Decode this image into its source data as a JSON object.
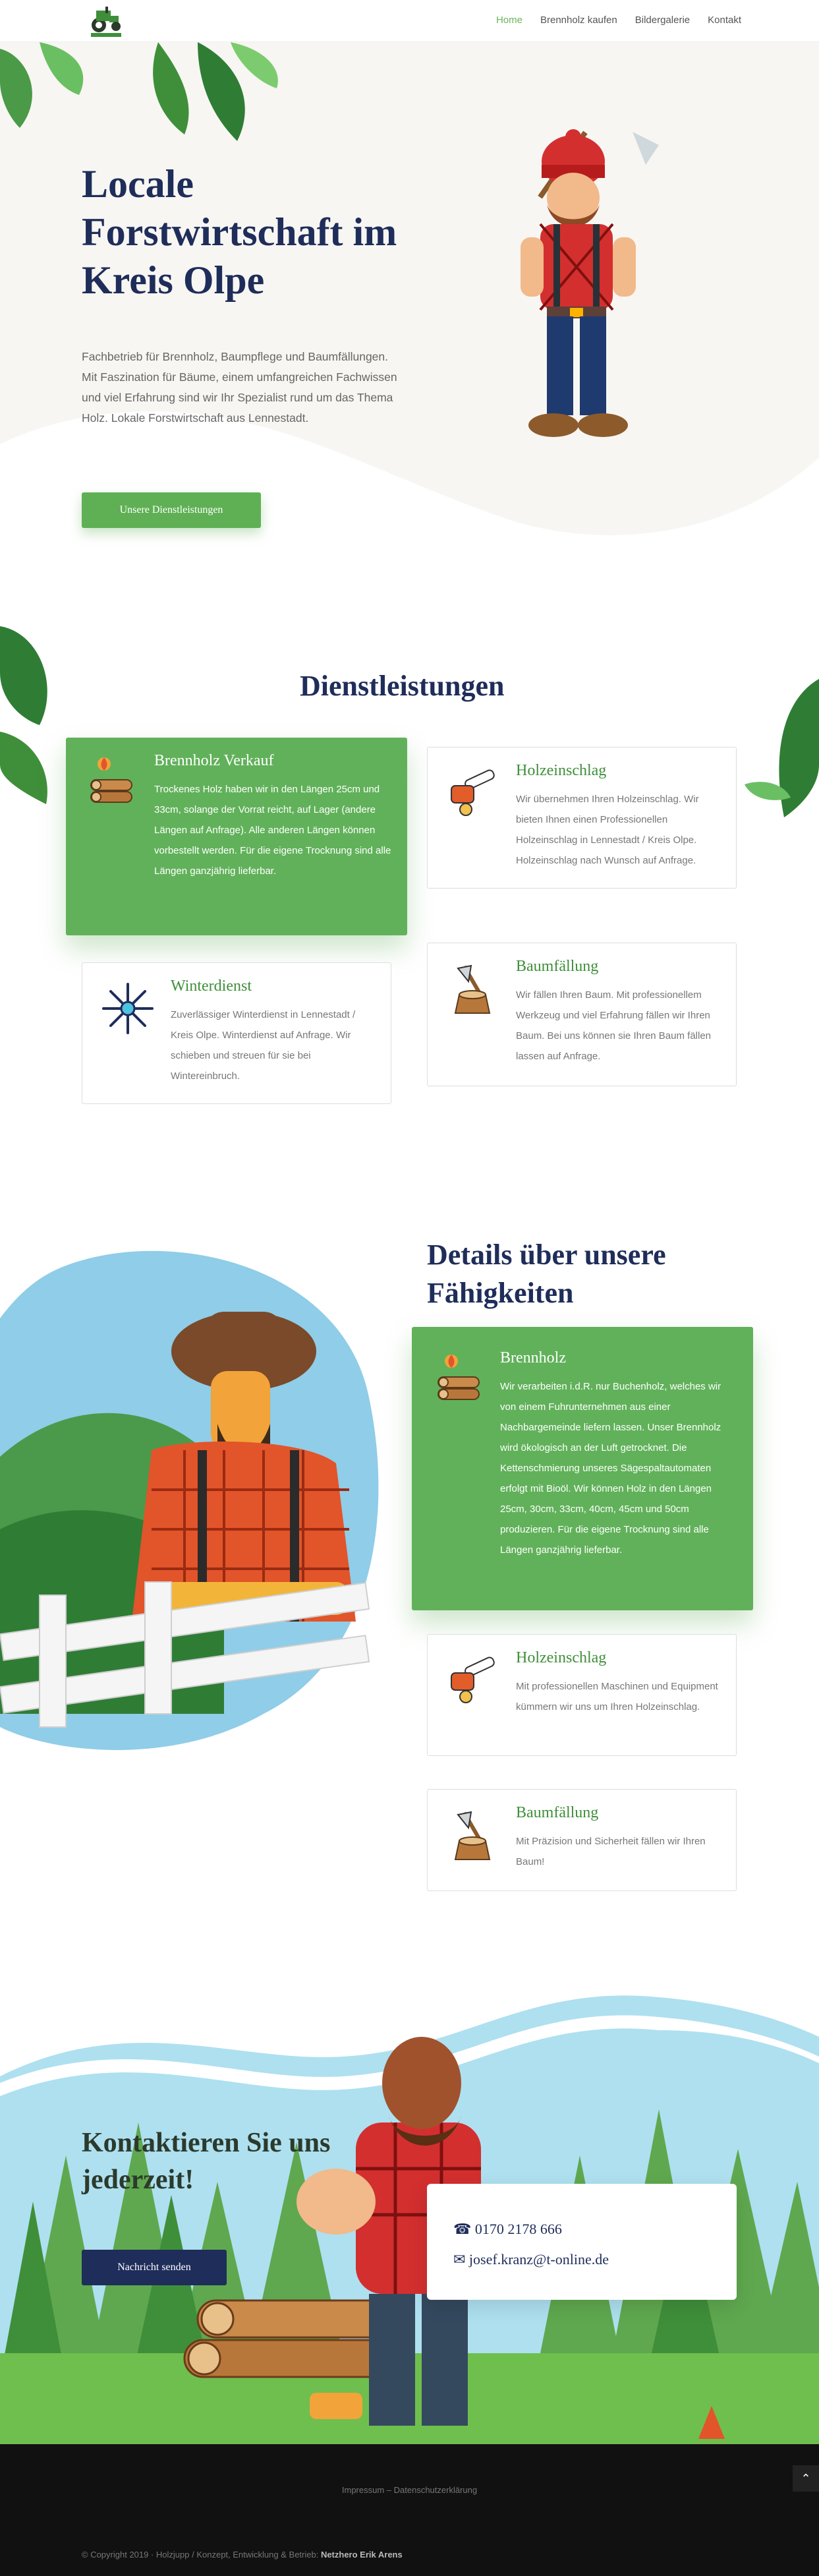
{
  "nav": {
    "items": [
      {
        "label": "Home",
        "active": true
      },
      {
        "label": "Brennholz kaufen",
        "active": false
      },
      {
        "label": "Bildergalerie",
        "active": false
      },
      {
        "label": "Kontakt",
        "active": false
      }
    ]
  },
  "hero": {
    "title": "Locale Forstwirtschaft im Kreis Olpe",
    "text": "Fachbetrieb für Brennholz, Baumpflege und Baumfällungen. Mit Faszination für Bäume, einem umfangreichen Fachwissen und viel Erfahrung sind wir Ihr Spezialist rund um das Thema Holz. Lokale Forstwirtschaft aus Lennestadt.",
    "button": "Unsere Dienstleistungen"
  },
  "services": {
    "title": "Dienstleistungen",
    "cards": [
      {
        "title": "Brennholz Verkauf",
        "text": "Trockenes Holz haben wir in den Längen 25cm und 33cm, solange der Vorrat reicht, auf Lager (andere Längen auf Anfrage). Alle anderen Längen können vorbestellt werden. Für die eigene Trocknung sind alle Längen ganzjährig lieferbar.",
        "icon": "firewood-icon"
      },
      {
        "title": "Holzeinschlag",
        "text": "Wir übernehmen Ihren Holzeinschlag. Wir bieten Ihnen einen Professionellen Holzeinschlag in Lennestadt / Kreis Olpe. Holzeinschlag nach Wunsch auf Anfrage.",
        "icon": "chainsaw-icon"
      },
      {
        "title": "Winterdienst",
        "text": "Zuverlässiger Winterdienst in Lennestadt / Kreis Olpe. Winterdienst auf Anfrage. Wir schieben und streuen für sie bei Wintereinbruch.",
        "icon": "snowflake-icon"
      },
      {
        "title": "Baumfällung",
        "text": "Wir fällen Ihren Baum. Mit professionellem Werkzeug und viel Erfahrung fällen wir Ihren Baum. Bei uns können sie Ihren Baum fällen lassen auf Anfrage.",
        "icon": "axe-stump-icon"
      }
    ]
  },
  "skills": {
    "title": "Details über unsere Fähigkeiten",
    "cards": [
      {
        "title": "Brennholz",
        "text": "Wir verarbeiten i.d.R. nur Buchenholz, welches wir von einem Fuhrunternehmen aus einer Nachbargemeinde liefern lassen. Unser Brennholz wird ökologisch an der Luft getrocknet. Die Kettenschmierung unseres Sägespaltautomaten erfolgt mit Bioöl. Wir können Holz in den Längen 25cm, 30cm, 33cm, 40cm, 45cm und 50cm produzieren. Für die eigene Trocknung sind alle Längen ganzjährig lieferbar.",
        "icon": "firewood-icon"
      },
      {
        "title": "Holzeinschlag",
        "text": "Mit professionellen Maschinen und Equipment kümmern wir uns um Ihren Holzeinschlag.",
        "icon": "chainsaw-icon"
      },
      {
        "title": "Baumfällung",
        "text": "Mit Präzision und Sicherheit fällen wir Ihren Baum!",
        "icon": "axe-stump-icon"
      }
    ]
  },
  "contact": {
    "title": "Kontaktieren Sie uns jederzeit!",
    "button": "Nachricht senden",
    "phone": "☎ 0170 2178 666",
    "email": "✉ josef.kranz@t-online.de"
  },
  "footer": {
    "links": "Impressum – Datenschutzerklärung",
    "copyright_prefix": "© Copyright 2019 · Holzjupp / Konzept, Entwicklung & Betrieb: ",
    "copyright_owner": "Netzhero Erik Arens",
    "to_top": "⌃"
  },
  "colors": {
    "green": "#61b15a",
    "navy": "#1f2d5a",
    "footer": "#111111"
  }
}
